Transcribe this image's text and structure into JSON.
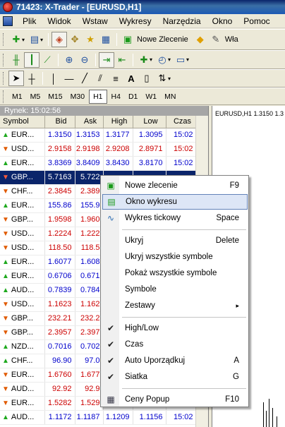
{
  "window": {
    "title": "71423: X-Trader - [EURUSD,H1]"
  },
  "menu": [
    "Plik",
    "Widok",
    "Wstaw",
    "Wykresy",
    "Narzędzia",
    "Okno",
    "Pomoc"
  ],
  "toolbar": {
    "new_order_label": "Nowe Zlecenie",
    "truncated_label": "Wła"
  },
  "periods": [
    "M1",
    "M5",
    "M15",
    "M30",
    "H1",
    "H4",
    "D1",
    "W1",
    "MN"
  ],
  "active_period": "H1",
  "market_watch": {
    "header": "Rynek: 15:02:56",
    "columns": [
      "Symbol",
      "Bid",
      "Ask",
      "High",
      "Low",
      "Czas"
    ],
    "rows": [
      {
        "dir": "up",
        "symbol": "EUR...",
        "bid": "1.3150",
        "ask": "1.3153",
        "high": "1.3177",
        "low": "1.3095",
        "time": "15:02",
        "color": "blue"
      },
      {
        "dir": "down",
        "symbol": "USD...",
        "bid": "2.9158",
        "ask": "2.9198",
        "high": "2.9208",
        "low": "2.8971",
        "time": "15:02",
        "color": "red"
      },
      {
        "dir": "up",
        "symbol": "EUR...",
        "bid": "3.8369",
        "ask": "3.8409",
        "high": "3.8430",
        "low": "3.8170",
        "time": "15:02",
        "color": "blue"
      },
      {
        "dir": "down",
        "symbol": "GBP...",
        "bid": "5.7163",
        "ask": "5.722",
        "high": "",
        "low": "",
        "time": "",
        "color": "sel"
      },
      {
        "dir": "down",
        "symbol": "CHF...",
        "bid": "2.3845",
        "ask": "2.389",
        "color": "red"
      },
      {
        "dir": "up",
        "symbol": "EUR...",
        "bid": "155.86",
        "ask": "155.9",
        "color": "blue"
      },
      {
        "dir": "down",
        "symbol": "GBP...",
        "bid": "1.9598",
        "ask": "1.960",
        "color": "red"
      },
      {
        "dir": "down",
        "symbol": "USD...",
        "bid": "1.2224",
        "ask": "1.222",
        "color": "red"
      },
      {
        "dir": "down",
        "symbol": "USD...",
        "bid": "118.50",
        "ask": "118.5",
        "color": "red"
      },
      {
        "dir": "up",
        "symbol": "EUR...",
        "bid": "1.6077",
        "ask": "1.608",
        "color": "blue"
      },
      {
        "dir": "up",
        "symbol": "EUR...",
        "bid": "0.6706",
        "ask": "0.671",
        "color": "blue"
      },
      {
        "dir": "up",
        "symbol": "AUD...",
        "bid": "0.7839",
        "ask": "0.784",
        "color": "blue"
      },
      {
        "dir": "down",
        "symbol": "USD...",
        "bid": "1.1623",
        "ask": "1.162",
        "color": "red"
      },
      {
        "dir": "down",
        "symbol": "GBP...",
        "bid": "232.21",
        "ask": "232.2",
        "color": "red"
      },
      {
        "dir": "down",
        "symbol": "GBP...",
        "bid": "2.3957",
        "ask": "2.397",
        "color": "red"
      },
      {
        "dir": "up",
        "symbol": "NZD...",
        "bid": "0.7016",
        "ask": "0.702",
        "color": "blue"
      },
      {
        "dir": "up",
        "symbol": "CHF...",
        "bid": "96.90",
        "ask": "97.0",
        "color": "blue"
      },
      {
        "dir": "down",
        "symbol": "EUR...",
        "bid": "1.6760",
        "ask": "1.677",
        "color": "red"
      },
      {
        "dir": "down",
        "symbol": "AUD...",
        "bid": "92.92",
        "ask": "92.9",
        "color": "red"
      },
      {
        "dir": "down",
        "symbol": "EUR...",
        "bid": "1.5282",
        "ask": "1.529",
        "color": "red"
      },
      {
        "dir": "up",
        "symbol": "AUD...",
        "bid": "1.1172",
        "ask": "1.1187",
        "high": "1.1209",
        "low": "1.1156",
        "time": "15:02",
        "color": "blue"
      }
    ]
  },
  "chart": {
    "title": "EURUSD,H1  1.3150 1.3"
  },
  "context_menu": {
    "items": [
      {
        "label": "Nowe zlecenie",
        "shortcut": "F9",
        "icon": "new-order-icon"
      },
      {
        "label": "Okno wykresu",
        "shortcut": "",
        "icon": "chart-window-icon",
        "highlighted": true
      },
      {
        "label": "Wykres tickowy",
        "shortcut": "Space",
        "icon": "tick-chart-icon"
      },
      {
        "sep": true
      },
      {
        "label": "Ukryj",
        "shortcut": "Delete"
      },
      {
        "label": "Ukryj wszystkie symbole",
        "shortcut": ""
      },
      {
        "label": "Pokaż wszystkie symbole",
        "shortcut": ""
      },
      {
        "label": "Symbole",
        "shortcut": ""
      },
      {
        "label": "Zestawy",
        "shortcut": "▸",
        "submenu": true
      },
      {
        "sep": true
      },
      {
        "label": "High/Low",
        "shortcut": "",
        "checked": true
      },
      {
        "label": "Czas",
        "shortcut": "",
        "checked": true
      },
      {
        "label": "Auto Uporządkuj",
        "shortcut": "A",
        "checked": true
      },
      {
        "label": "Siatka",
        "shortcut": "G",
        "checked": true
      },
      {
        "sep": true
      },
      {
        "label": "Ceny Popup",
        "shortcut": "F10",
        "icon": "popup-prices-icon"
      }
    ]
  }
}
